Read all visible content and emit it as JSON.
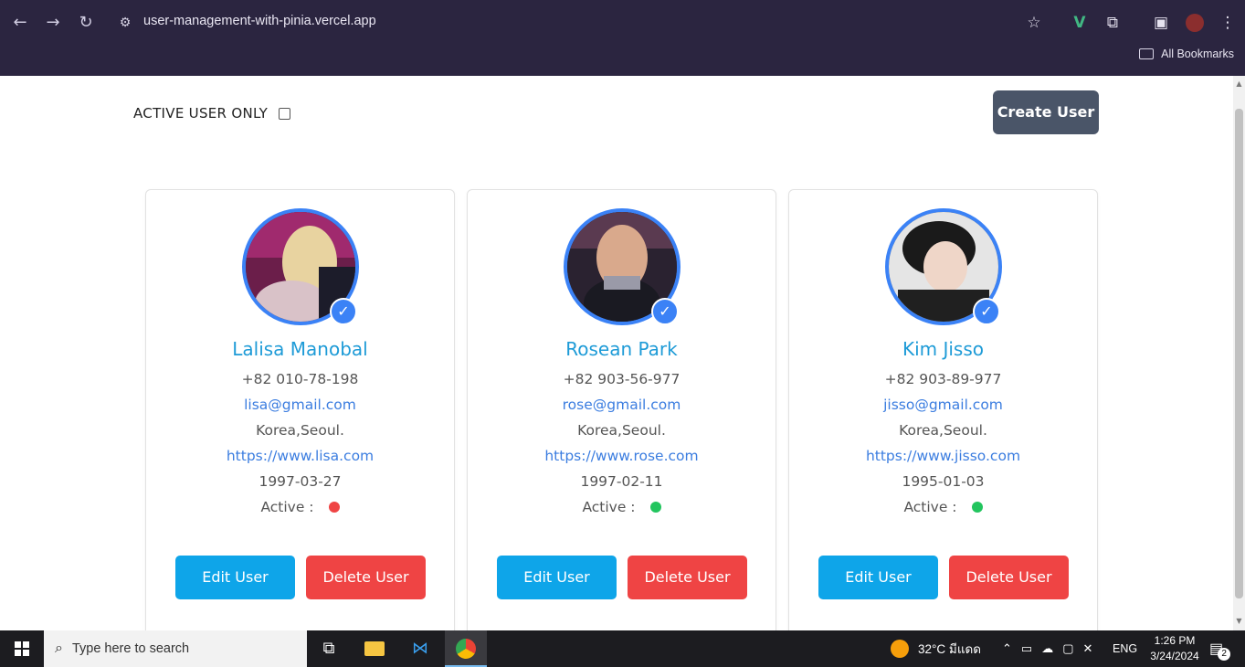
{
  "browser": {
    "url": "user-management-with-pinia.vercel.app",
    "bookmarks_label": "All Bookmarks"
  },
  "page": {
    "filter_label": "ACTIVE USER ONLY",
    "filter_checked": false,
    "create_button": "Create User",
    "active_label": "Active :",
    "edit_button": "Edit User",
    "delete_button": "Delete User"
  },
  "users": [
    {
      "name": "Lalisa Manobal",
      "phone": "+82 010-78-198",
      "email": "lisa@gmail.com",
      "address": "Korea,Seoul.",
      "website": "https://www.lisa.com",
      "birthday": "1997-03-27",
      "active": false,
      "status_color": "#ef4444"
    },
    {
      "name": "Rosean Park",
      "phone": "+82 903-56-977",
      "email": "rose@gmail.com",
      "address": "Korea,Seoul.",
      "website": "https://www.rose.com",
      "birthday": "1997-02-11",
      "active": true,
      "status_color": "#22c55e"
    },
    {
      "name": "Kim Jisso",
      "phone": "+82 903-89-977",
      "email": "jisso@gmail.com",
      "address": "Korea,Seoul.",
      "website": "https://www.jisso.com",
      "birthday": "1995-01-03",
      "active": true,
      "status_color": "#22c55e"
    }
  ],
  "taskbar": {
    "search_placeholder": "Type here to search",
    "weather": "32°C  มีแดด",
    "language": "ENG",
    "time": "1:26 PM",
    "date": "3/24/2024",
    "notifications": "2"
  }
}
